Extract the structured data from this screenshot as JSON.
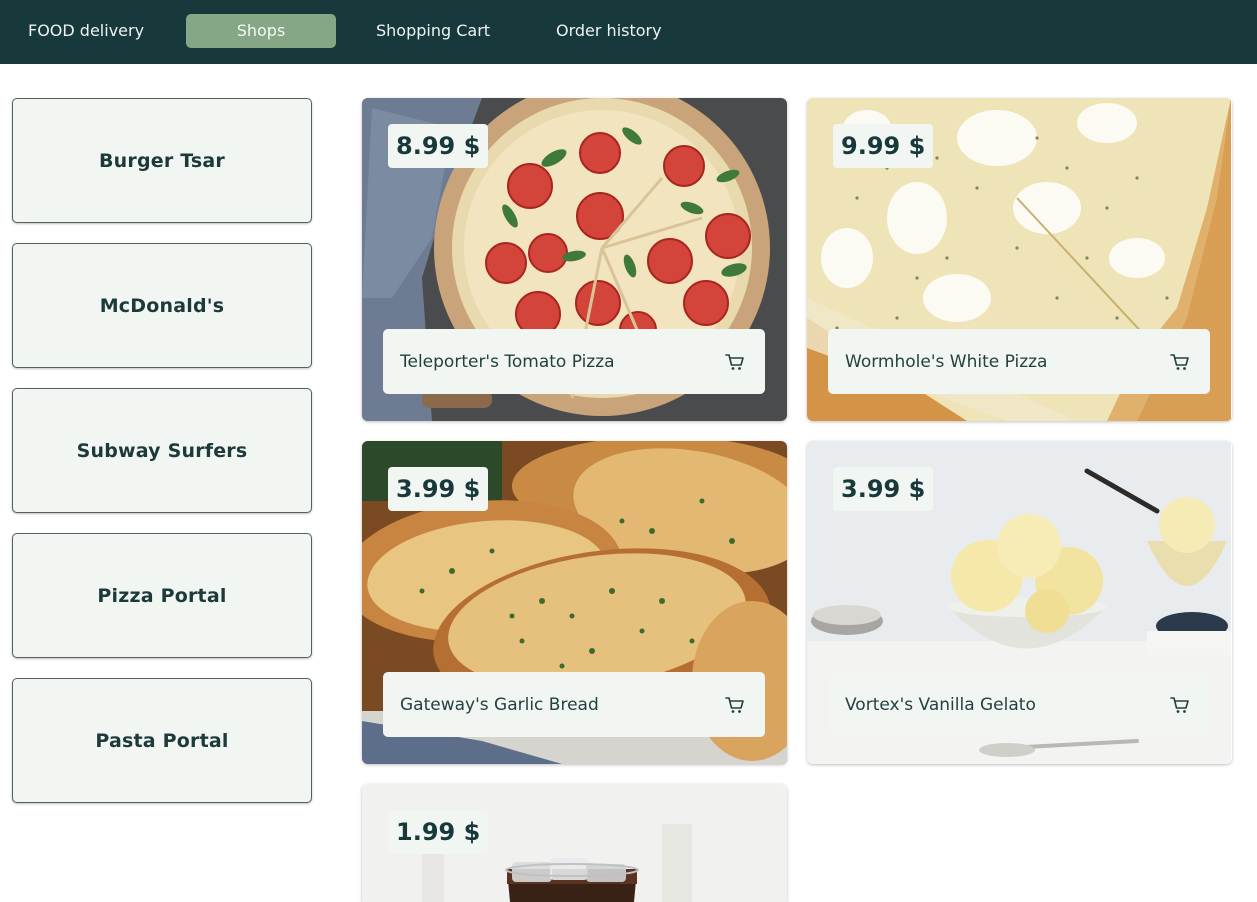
{
  "nav": {
    "brand": "FOOD delivery",
    "tabs": [
      {
        "label": "Shops",
        "active": true
      },
      {
        "label": "Shopping Cart",
        "active": false
      },
      {
        "label": "Order history",
        "active": false
      }
    ]
  },
  "shops": [
    {
      "label": "Burger Tsar"
    },
    {
      "label": "McDonald's"
    },
    {
      "label": "Subway Surfers"
    },
    {
      "label": "Pizza Portal"
    },
    {
      "label": "Pasta Portal"
    }
  ],
  "products": [
    {
      "price": "8.99 $",
      "name": "Teleporter's Tomato Pizza",
      "image": "tomato-pizza-photo"
    },
    {
      "price": "9.99 $",
      "name": "Wormhole's White Pizza",
      "image": "white-pizza-photo"
    },
    {
      "price": "3.99 $",
      "name": "Gateway's Garlic Bread",
      "image": "garlic-bread-photo"
    },
    {
      "price": "3.99 $",
      "name": "Vortex's Vanilla Gelato",
      "image": "vanilla-gelato-photo"
    },
    {
      "price": "1.99 $",
      "name": "",
      "image": "cola-glass-photo"
    }
  ],
  "icons": {
    "cart": "shopping-cart-icon"
  },
  "colors": {
    "navbar": "#17393b",
    "active_tab": "#86a785",
    "card_surface": "#f2f6f2",
    "text_dark": "#17393b"
  }
}
